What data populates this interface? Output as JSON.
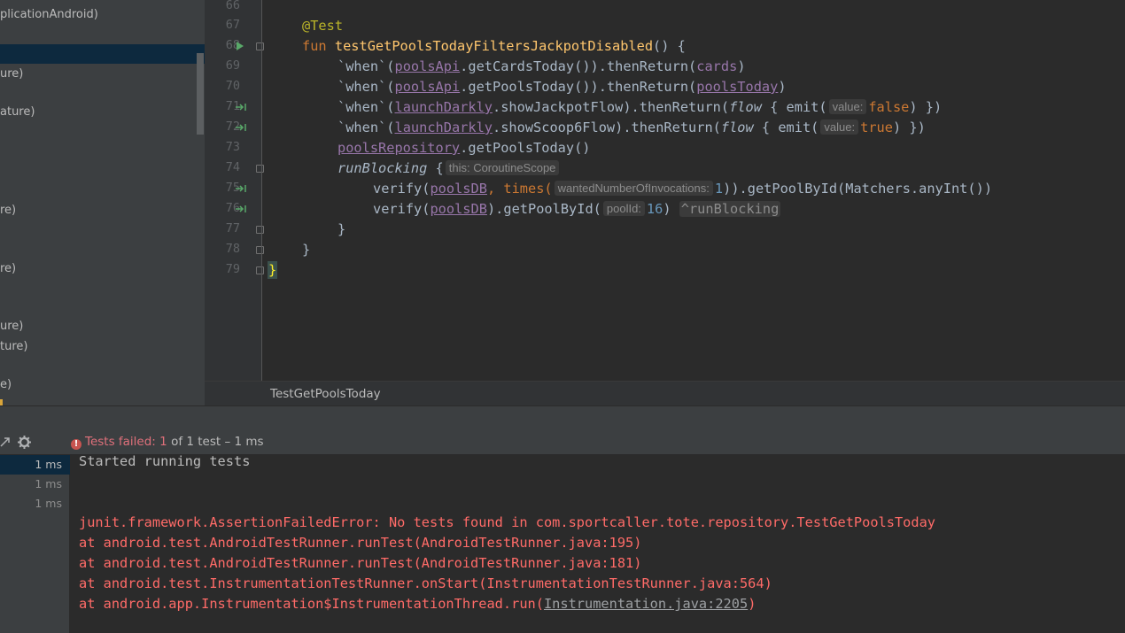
{
  "project_panel": {
    "items": [
      {
        "label": "plicationAndroid)",
        "selected": false
      },
      {
        "label": "",
        "selected": true
      },
      {
        "label": "ure)",
        "selected": false
      },
      {
        "label": "ature)",
        "selected": false
      },
      {
        "label": "re)",
        "selected": false
      },
      {
        "label": "re)",
        "selected": false
      },
      {
        "label": "ure)",
        "selected": false
      },
      {
        "label": "ture)",
        "selected": false
      },
      {
        "label": "e)",
        "selected": false
      }
    ]
  },
  "editor": {
    "line_numbers": [
      "66",
      "67",
      "68",
      "69",
      "70",
      "71",
      "72",
      "73",
      "74",
      "75",
      "76",
      "77",
      "78",
      "79"
    ],
    "code": {
      "l67_annotation": "@Test",
      "l68_kw": "fun",
      "l68_fn": "testGetPoolsTodayFiltersJackpotDisabled",
      "l68_rest": "() {",
      "when": "`when`",
      "paren_open": "(",
      "poolsApi": "poolsApi",
      "getCardsToday": ".getCardsToday()).thenReturn(",
      "cards": "cards",
      "close_paren": ")",
      "getPoolsToday": ".getPoolsToday()).thenReturn(",
      "poolsToday": "poolsToday",
      "launchDarkly": "launchDarkly",
      "showJackpotFlow": ".showJackpotFlow).thenReturn(",
      "showScoop6Flow": ".showScoop6Flow).thenReturn(",
      "flow": "flow",
      "emit_open": " { emit(",
      "hint_value": "value:",
      "false_kw": "false",
      "true_kw": "true",
      "emit_close": ") })",
      "poolsRepository": "poolsRepository",
      "repo_call": ".getPoolsToday()",
      "runBlocking": "runBlocking",
      "brace_open": " {",
      "hint_this": "this: CoroutineScope",
      "verify_open": "verify(",
      "poolsDB": "poolsDB",
      "times_call": ", times(",
      "hint_wanted": "wantedNumberOfInvocations:",
      "one": "1",
      "pool_by_id_matchers": ")).getPoolById(Matchers.anyInt())",
      "pool_by_id_open": ").getPoolById(",
      "hint_poolid": "poolId:",
      "sixteen": "16",
      "l76_close": ") ",
      "hint_runblocking": "^runBlocking",
      "brace_close": "}"
    },
    "breadcrumb": "TestGetPoolsToday"
  },
  "run_panel": {
    "status": {
      "label": "Tests failed:",
      "count": "1",
      "rest": "of 1 test – 1 ms"
    },
    "tree_times": [
      "1 ms",
      "1 ms",
      "1 ms"
    ],
    "console": {
      "started": "Started running tests",
      "error_lines": [
        "junit.framework.AssertionFailedError: No tests found in com.sportcaller.tote.repository.TestGetPoolsToday",
        "at android.test.AndroidTestRunner.runTest(AndroidTestRunner.java:195)",
        "at android.test.AndroidTestRunner.runTest(AndroidTestRunner.java:181)",
        "at android.test.InstrumentationTestRunner.onStart(InstrumentationTestRunner.java:564)"
      ],
      "last_prefix": "at android.app.Instrumentation$InstrumentationThread.run(",
      "last_link": "Instrumentation.java:2205",
      "last_suffix": ")"
    }
  },
  "colors": {
    "keyword": "#cc7832",
    "function": "#ffc66d",
    "property": "#9876aa",
    "number": "#6897bb",
    "error": "#ff6b68"
  }
}
